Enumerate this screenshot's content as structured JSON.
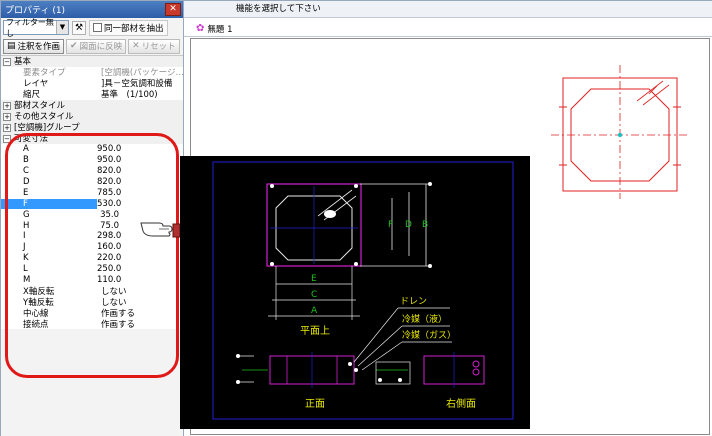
{
  "panel": {
    "title": "プロパティ (1)",
    "filter_value": "フィルター無し",
    "same_member_label": "同一部材を抽出",
    "annotate_button": "注釈を作画",
    "reflect_button": "図面に反映",
    "reset_button": "リセット"
  },
  "rows": {
    "basic": "基本",
    "element_type": {
      "k": "要素タイプ",
      "v": "[空調機(パッケージ…"
    },
    "layer": {
      "k": "レイヤ",
      "v": "]具－空気調和設備"
    },
    "scale": {
      "k": "縮尺",
      "v": "基準　(1/100)"
    },
    "member_style": "部材スタイル",
    "other_style": "その他スタイル",
    "group": "[空調機]グループ",
    "variable": "可変寸法",
    "dims": [
      {
        "k": "A",
        "v": "950.0"
      },
      {
        "k": "B",
        "v": "950.0"
      },
      {
        "k": "C",
        "v": "820.0"
      },
      {
        "k": "D",
        "v": "820.0"
      },
      {
        "k": "E",
        "v": "785.0"
      },
      {
        "k": "F",
        "v": "530.0"
      },
      {
        "k": "G",
        "v": "35.0"
      },
      {
        "k": "H",
        "v": "75.0"
      },
      {
        "k": "I",
        "v": "298.0"
      },
      {
        "k": "J",
        "v": "160.0"
      },
      {
        "k": "K",
        "v": "220.0"
      },
      {
        "k": "L",
        "v": "250.0"
      },
      {
        "k": "M",
        "v": "110.0"
      }
    ],
    "x_flip": {
      "k": "X軸反転",
      "v": "しない"
    },
    "y_flip": {
      "k": "Y軸反転",
      "v": "しない"
    },
    "center_line": {
      "k": "中心線",
      "v": "作画する"
    },
    "connection": {
      "k": "接続点",
      "v": "作画する"
    }
  },
  "main": {
    "status_text": "機能を選択して下さい",
    "tab_label": "無題 1"
  },
  "preview": {
    "plan_label": "平面上",
    "front_label": "正面",
    "side_label": "右側面",
    "drain_label": "ドレン",
    "liquid_label": "冷媒（液）",
    "gas_label": "冷媒（ガス）",
    "dim_labels": [
      "E",
      "C",
      "A",
      "F",
      "D",
      "B"
    ]
  },
  "colors": {
    "accent_blue": "#2e5da8",
    "highlight_red": "#e01818",
    "cad_red": "#e02020",
    "magenta": "#d020d0",
    "cad_green": "#00c000",
    "cad_yellow": "#e8e800",
    "selection": "#3399ff"
  }
}
